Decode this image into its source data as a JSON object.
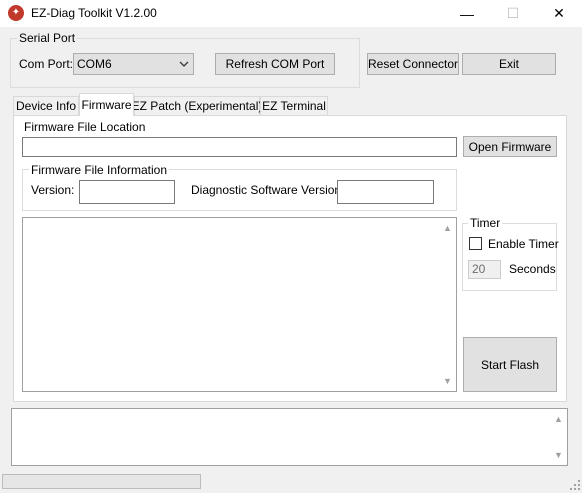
{
  "window": {
    "title": "EZ-Diag Toolkit V1.2.00",
    "icon": "app-logo-icon",
    "controls": {
      "minimize": "—",
      "maximize": "☐",
      "close": "✕"
    }
  },
  "serial_port": {
    "group_label": "Serial Port",
    "com_port_label": "Com Port:",
    "com_port_value": "COM6",
    "refresh_button": "Refresh COM Port"
  },
  "toolbar": {
    "reset_button": "Reset Connector",
    "exit_button": "Exit"
  },
  "tabs": [
    {
      "label": "Device Info",
      "active": false
    },
    {
      "label": "Firmware",
      "active": true
    },
    {
      "label": "EZ Patch (Experimental)",
      "active": false
    },
    {
      "label": "EZ Terminal",
      "active": false
    }
  ],
  "firmware": {
    "file_location_label": "Firmware File Location",
    "file_location_value": "",
    "open_button": "Open Firmware",
    "info_group_label": "Firmware File Information",
    "version_label": "Version:",
    "version_value": "",
    "diag_version_label": "Diagnostic Software Version:",
    "diag_version_value": "",
    "output_text": ""
  },
  "timer": {
    "group_label": "Timer",
    "enable_label": "Enable Timer",
    "enabled": false,
    "seconds_value": "20",
    "seconds_label": "Seconds"
  },
  "start_flash_button": "Start Flash",
  "log_text": ""
}
